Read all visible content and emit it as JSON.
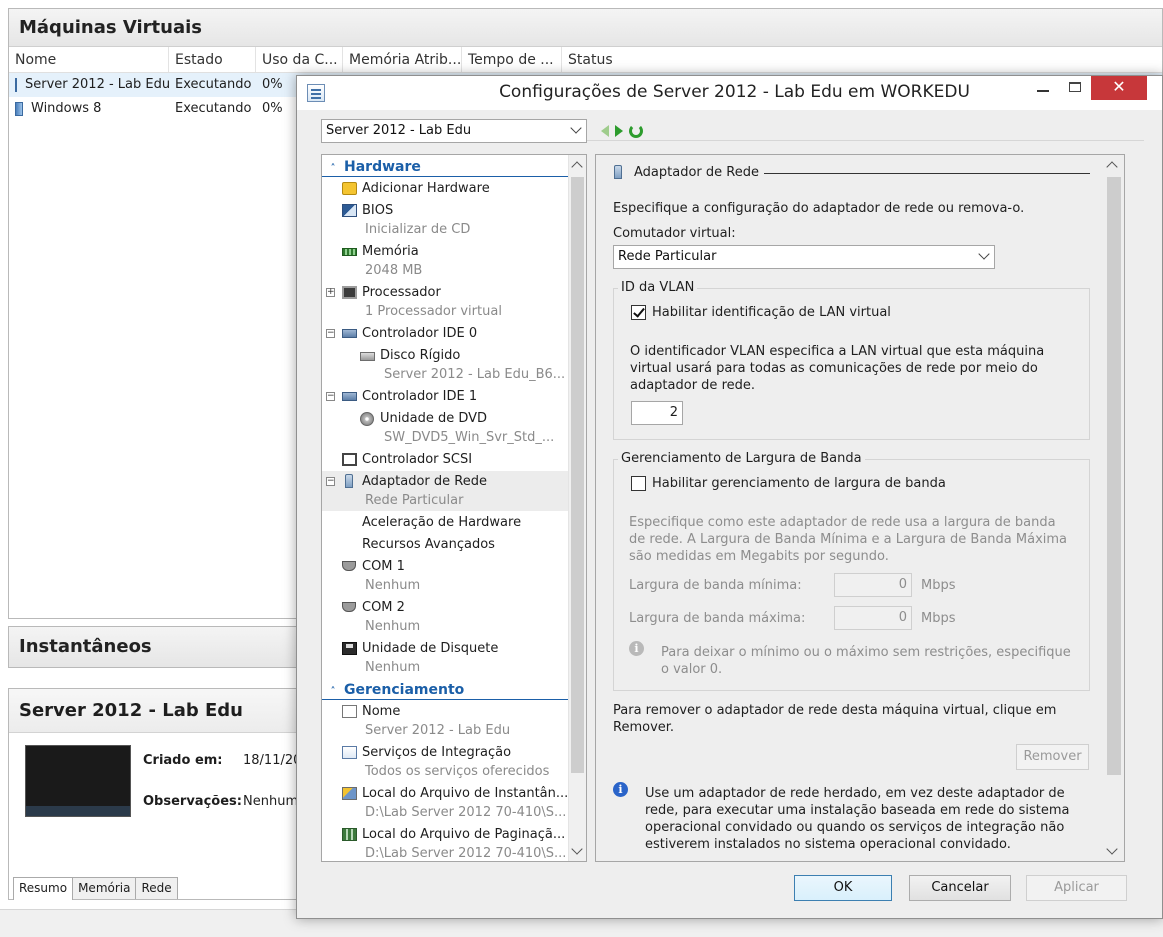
{
  "manager": {
    "vms_title": "Máquinas Virtuais",
    "columns": [
      "Nome",
      "Estado",
      "Uso da C...",
      "Memória Atrib...",
      "Tempo de ...",
      "Status"
    ],
    "rows": [
      {
        "name": "Server 2012 - Lab Edu",
        "state": "Executando",
        "cpu": "0%"
      },
      {
        "name": "Windows 8",
        "state": "Executando",
        "cpu": "0%"
      }
    ],
    "snapshots_title": "Instantâneos",
    "detail_title": "Server 2012 - Lab Edu",
    "created_label": "Criado em:",
    "created_value": "18/11/20",
    "notes_label": "Observações:",
    "notes_value": "Nenhum",
    "tabs": [
      "Resumo",
      "Memória",
      "Rede"
    ]
  },
  "dialog": {
    "title": "Configurações de Server 2012 - Lab Edu em WORKEDU",
    "close_glyph": "✕",
    "vm_select": "Server 2012 - Lab Edu",
    "tree": {
      "hardware_label": "Hardware",
      "management_label": "Gerenciamento",
      "items": {
        "add_hw": "Adicionar Hardware",
        "bios": "BIOS",
        "bios_sub": "Inicializar de CD",
        "memory": "Memória",
        "memory_sub": "2048 MB",
        "processor": "Processador",
        "processor_sub": "1 Processador virtual",
        "ide0": "Controlador IDE 0",
        "hdd": "Disco Rígido",
        "hdd_sub": "Server 2012 - Lab Edu_B6...",
        "ide1": "Controlador IDE 1",
        "dvd": "Unidade de DVD",
        "dvd_sub": "SW_DVD5_Win_Svr_Std_...",
        "scsi": "Controlador SCSI",
        "net": "Adaptador de Rede",
        "net_sub": "Rede Particular",
        "hw_accel": "Aceleração de Hardware",
        "adv": "Recursos Avançados",
        "com1": "COM 1",
        "com1_sub": "Nenhum",
        "com2": "COM 2",
        "com2_sub": "Nenhum",
        "floppy": "Unidade de Disquete",
        "floppy_sub": "Nenhum",
        "name": "Nome",
        "name_sub": "Server 2012 - Lab Edu",
        "integ": "Serviços de Integração",
        "integ_sub": "Todos os serviços oferecidos",
        "snap_loc": "Local do Arquivo de Instantân...",
        "snap_loc_sub": "D:\\Lab Server 2012 70-410\\S...",
        "page_loc": "Local do Arquivo de Paginaçã...",
        "page_loc_sub": "D:\\Lab Server 2012 70-410\\S..."
      }
    },
    "panel": {
      "heading": "Adaptador de Rede",
      "intro": "Especifique a configuração do adaptador de rede ou remova-o.",
      "switch_label": "Comutador virtual:",
      "switch_value": "Rede Particular",
      "vlan_group": "ID da VLAN",
      "vlan_checkbox": "Habilitar identificação de LAN virtual",
      "vlan_desc": "O identificador VLAN especifica a LAN virtual que esta máquina virtual usará para todas as comunicações de rede por meio do adaptador de rede.",
      "vlan_id": "2",
      "bw_group": "Gerenciamento de Largura de Banda",
      "bw_checkbox": "Habilitar gerenciamento de largura de banda",
      "bw_desc": "Especifique como este adaptador de rede usa a largura de banda de rede. A Largura de Banda Mínima e a Largura de Banda Máxima são medidas em Megabits por segundo.",
      "bw_min_label": "Largura de banda mínima:",
      "bw_min_value": "0",
      "bw_max_label": "Largura de banda máxima:",
      "bw_max_value": "0",
      "unit": "Mbps",
      "bw_hint": "Para deixar o mínimo ou o máximo sem restrições, especifique o valor 0.",
      "remove_desc": "Para remover o adaptador de rede desta máquina virtual, clique em Remover.",
      "remove_button": "Remover",
      "legacy_info": "Use um adaptador de rede herdado, em vez deste adaptador de rede, para executar uma instalação baseada em rede do sistema operacional convidado ou quando os serviços de integração não estiverem instalados no sistema operacional convidado."
    },
    "buttons": {
      "ok": "OK",
      "cancel": "Cancelar",
      "apply": "Aplicar"
    }
  },
  "colors": {
    "accent_blue": "#1b5fa8",
    "close_red": "#c7373a",
    "selected_row": "#e5f1fb"
  }
}
